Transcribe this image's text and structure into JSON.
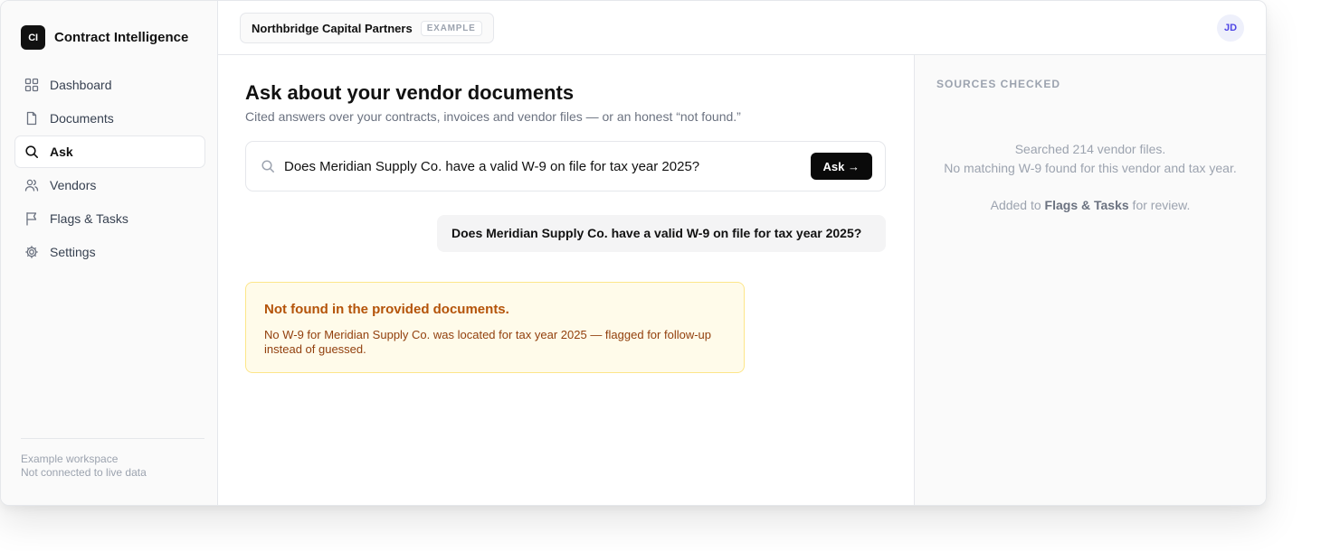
{
  "brand": {
    "logo_text": "CI",
    "name": "Contract Intelligence"
  },
  "sidebar": {
    "items": [
      {
        "label": "Dashboard",
        "icon": "grid-icon"
      },
      {
        "label": "Documents",
        "icon": "file-icon"
      },
      {
        "label": "Ask",
        "icon": "search-icon",
        "active": true
      },
      {
        "label": "Vendors",
        "icon": "users-icon"
      },
      {
        "label": "Flags & Tasks",
        "icon": "flag-icon"
      },
      {
        "label": "Settings",
        "icon": "gear-icon"
      }
    ],
    "footer": {
      "line1": "Example workspace",
      "line2": "Not connected to live data"
    }
  },
  "topbar": {
    "org_name": "Northbridge Capital Partners",
    "org_badge": "EXAMPLE",
    "avatar_initials": "JD"
  },
  "main": {
    "title": "Ask about your vendor documents",
    "subtitle": "Cited answers over your contracts, invoices and vendor files — or an honest “not found.”",
    "search": {
      "value": "Does Meridian Supply Co. have a valid W-9 on file for tax year 2025?",
      "button_label": "Ask →"
    },
    "user_message": "Does Meridian Supply Co. have a valid W-9 on file for tax year 2025?",
    "result": {
      "title": "Not found in the provided documents.",
      "text": "No W-9 for Meridian Supply Co. was located for tax year 2025 — flagged for follow-up instead of guessed."
    }
  },
  "sources": {
    "title": "SOURCES CHECKED",
    "line1": "Searched 214 vendor files.",
    "line2": "No matching W-9 found for this vendor and tax year.",
    "added_prefix": "Added to ",
    "added_link": "Flags & Tasks",
    "added_suffix": " for review."
  },
  "colors": {
    "accent": "#0a0a0a",
    "warning_bg": "#fffbea",
    "warning_title": "#b45309",
    "warning_text": "#92400e",
    "avatar": "#4f46e5"
  }
}
